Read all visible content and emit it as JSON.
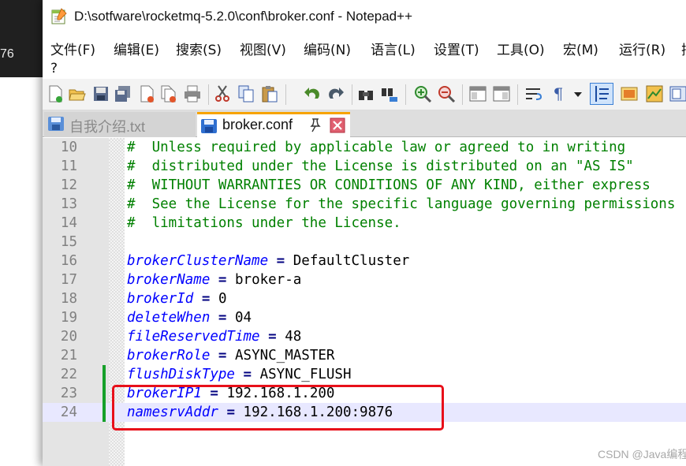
{
  "background": {
    "partial_text": "76"
  },
  "window": {
    "title": "D:\\sotfware\\rocketmq-5.2.0\\conf\\broker.conf - Notepad++"
  },
  "menu": [
    {
      "label": "文件(F)"
    },
    {
      "label": "编辑(E)"
    },
    {
      "label": "搜索(S)"
    },
    {
      "label": "视图(V)"
    },
    {
      "label": "编码(N)"
    },
    {
      "label": "语言(L)"
    },
    {
      "label": "设置(T)"
    },
    {
      "label": "工具(O)"
    },
    {
      "label": "宏(M)"
    },
    {
      "label": "运行(R)"
    },
    {
      "label": "插"
    }
  ],
  "menu_help": "?",
  "toolbar_icons": [
    "new-file-icon",
    "open-file-icon",
    "save-icon",
    "save-all-icon",
    "close-icon",
    "close-all-icon",
    "print-icon",
    "cut-icon",
    "copy-icon",
    "paste-icon",
    "undo-icon",
    "redo-icon",
    "find-icon",
    "replace-icon",
    "zoom-in-icon",
    "zoom-out-icon",
    "sync-vertical-icon",
    "sync-horizontal-icon",
    "word-wrap-icon",
    "show-all-chars-icon",
    "dropdown-icon",
    "indent-guide-icon",
    "udl-icon",
    "doc-map-icon",
    "function-list-icon"
  ],
  "tabs": [
    {
      "label": "自我介绍.txt",
      "active": false
    },
    {
      "label": "broker.conf",
      "active": true
    }
  ],
  "editor": {
    "lines": [
      {
        "number": "10",
        "type": "comment",
        "text": "#  Unless required by applicable law or agreed to in writing"
      },
      {
        "number": "11",
        "type": "comment",
        "text": "#  distributed under the License is distributed on an \"AS IS\""
      },
      {
        "number": "12",
        "type": "comment",
        "text": "#  WITHOUT WARRANTIES OR CONDITIONS OF ANY KIND, either express"
      },
      {
        "number": "13",
        "type": "comment",
        "text": "#  See the License for the specific language governing permissions"
      },
      {
        "number": "14",
        "type": "comment",
        "text": "#  limitations under the License."
      },
      {
        "number": "15",
        "type": "blank",
        "text": ""
      },
      {
        "number": "16",
        "type": "kv",
        "key": "brokerClusterName",
        "eq": "=",
        "value": "DefaultCluster"
      },
      {
        "number": "17",
        "type": "kv",
        "key": "brokerName",
        "eq": "=",
        "value": "broker-a"
      },
      {
        "number": "18",
        "type": "kv",
        "key": "brokerId",
        "eq": "=",
        "value": "0"
      },
      {
        "number": "19",
        "type": "kv",
        "key": "deleteWhen",
        "eq": "=",
        "value": "04"
      },
      {
        "number": "20",
        "type": "kv",
        "key": "fileReservedTime",
        "eq": "=",
        "value": "48"
      },
      {
        "number": "21",
        "type": "kv",
        "key": "brokerRole",
        "eq": "=",
        "value": "ASYNC_MASTER"
      },
      {
        "number": "22",
        "type": "kv",
        "key": "flushDiskType",
        "eq": "=",
        "value": "ASYNC_FLUSH",
        "changed": true
      },
      {
        "number": "23",
        "type": "kv",
        "key": "brokerIP1",
        "eq": "=",
        "value": "192.168.1.200",
        "changed": true
      },
      {
        "number": "24",
        "type": "kv",
        "key": "namesrvAddr",
        "eq": "=",
        "value": "192.168.1.200:9876",
        "changed": true,
        "current": true
      }
    ]
  },
  "watermark": "CSDN @Java编程之道",
  "colors": {
    "comment": "#008000",
    "key": "#0000ff",
    "operator": "#000080",
    "highlight_box": "#e8101a",
    "current_line": "#e8e8ff",
    "change_marker": "#16a029",
    "active_tab_accent": "#f7a300"
  }
}
